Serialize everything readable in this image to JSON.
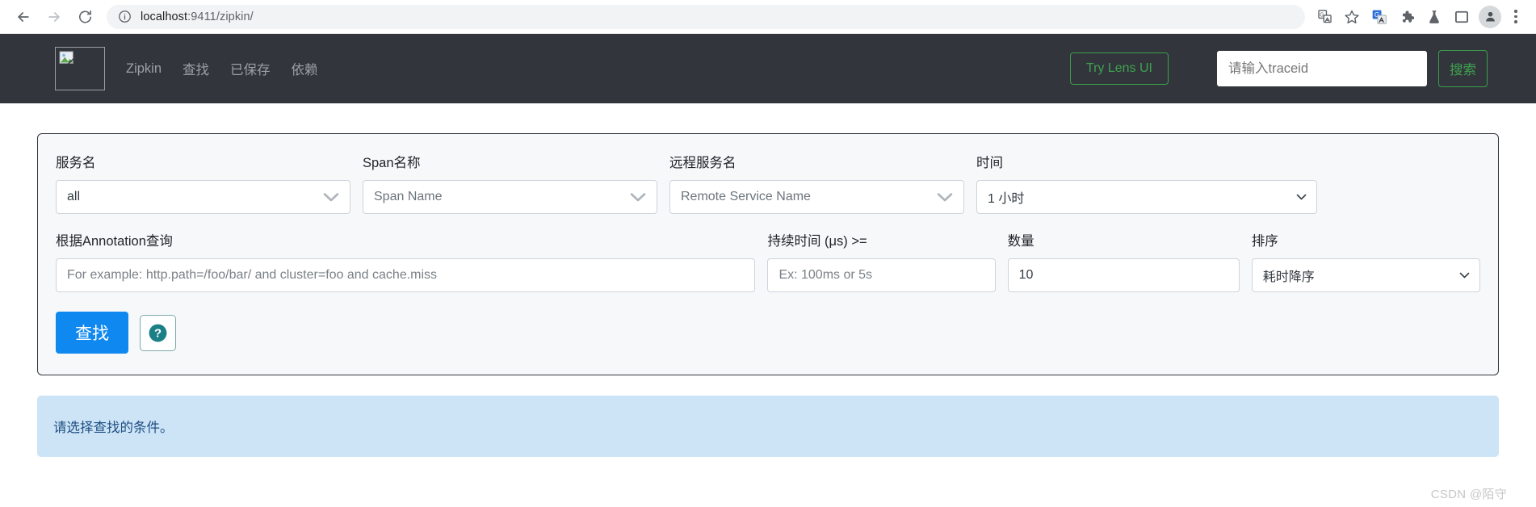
{
  "browser": {
    "back_icon": "back-arrow-icon",
    "forward_icon": "forward-arrow-icon",
    "reload_icon": "reload-icon",
    "site_info_icon": "info-circle-icon",
    "url_host": "localhost",
    "url_path": ":9411/zipkin/",
    "toolbar_icons": [
      "translate-icon",
      "bookmark-star-icon",
      "google-translate-extension-icon",
      "extensions-puzzle-icon",
      "lab-flask-icon",
      "side-panel-icon"
    ],
    "profile_icon": "profile-avatar-icon",
    "menu_icon": "three-dot-menu-icon"
  },
  "header": {
    "logo_alt": "broken-image-placeholder",
    "brand": "Zipkin",
    "nav": [
      {
        "label": "查找"
      },
      {
        "label": "已保存"
      },
      {
        "label": "依赖"
      }
    ],
    "lens_button": "Try Lens UI",
    "trace_placeholder": "请输入traceid",
    "trace_value": "",
    "search_button": "搜索",
    "bg_color": "#32363c",
    "accent_green": "#3fa14f"
  },
  "search_form": {
    "service_name": {
      "label": "服务名",
      "value": "all",
      "options": [
        "all"
      ]
    },
    "span_name": {
      "label": "Span名称",
      "placeholder": "Span Name",
      "value": ""
    },
    "remote_service_name": {
      "label": "远程服务名",
      "placeholder": "Remote Service Name",
      "value": ""
    },
    "lookback": {
      "label": "时间",
      "value": "1 小时",
      "options": [
        "1 小时"
      ]
    },
    "annotation_query": {
      "label": "根据Annotation查询",
      "placeholder": "For example: http.path=/foo/bar/ and cluster=foo and cache.miss",
      "value": ""
    },
    "duration": {
      "label": "持续时间 (μs) >=",
      "placeholder": "Ex: 100ms or 5s",
      "value": ""
    },
    "limit": {
      "label": "数量",
      "value": "10"
    },
    "sort_order": {
      "label": "排序",
      "value": "耗时降序",
      "options": [
        "耗时降序"
      ]
    },
    "find_button": "查找",
    "help_icon": "question-mark-circle-icon",
    "find_button_color": "#0f88ef"
  },
  "notice": {
    "message": "请选择查找的条件。",
    "bg_color": "#cde4f7",
    "text_color": "#1f4f82"
  },
  "watermark": {
    "text": "CSDN @陌守"
  }
}
